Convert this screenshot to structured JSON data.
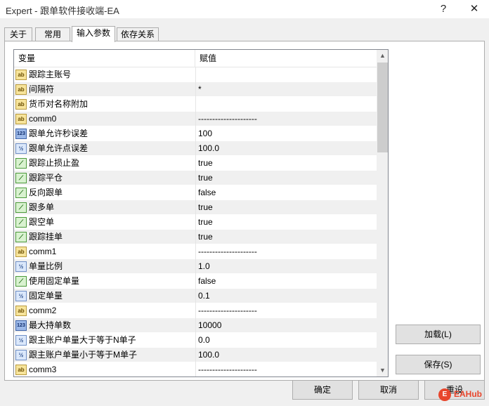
{
  "window": {
    "title": "Expert - 跟单软件接收端-EA",
    "help_glyph": "?",
    "close_glyph": "✕"
  },
  "tabs": [
    {
      "label": "关于"
    },
    {
      "label": "常用"
    },
    {
      "label": "输入参数",
      "active": true
    },
    {
      "label": "依存关系"
    }
  ],
  "grid": {
    "headers": {
      "variable": "变量",
      "value": "赋值"
    },
    "rows": [
      {
        "icon": "string-type-icon",
        "tag": "ab",
        "name": "跟踪主账号",
        "value": ""
      },
      {
        "icon": "string-type-icon",
        "tag": "ab",
        "name": "间隔符",
        "value": "*"
      },
      {
        "icon": "string-type-icon",
        "tag": "ab",
        "name": "货币对名称附加",
        "value": ""
      },
      {
        "icon": "string-type-icon",
        "tag": "ab",
        "name": "comm0",
        "value": "---------------------"
      },
      {
        "icon": "integer-type-icon",
        "tag": "123",
        "name": "跟单允许秒误差",
        "value": "100"
      },
      {
        "icon": "double-type-icon",
        "tag": "½",
        "name": "跟单允许点误差",
        "value": "100.0"
      },
      {
        "icon": "bool-type-icon",
        "tag": "⟋",
        "name": "跟踪止损止盈",
        "value": "true"
      },
      {
        "icon": "bool-type-icon",
        "tag": "⟋",
        "name": "跟踪平仓",
        "value": "true"
      },
      {
        "icon": "bool-type-icon",
        "tag": "⟋",
        "name": "反向跟单",
        "value": "false"
      },
      {
        "icon": "bool-type-icon",
        "tag": "⟋",
        "name": "跟多单",
        "value": "true"
      },
      {
        "icon": "bool-type-icon",
        "tag": "⟋",
        "name": "跟空单",
        "value": "true"
      },
      {
        "icon": "bool-type-icon",
        "tag": "⟋",
        "name": "跟踪挂单",
        "value": "true"
      },
      {
        "icon": "string-type-icon",
        "tag": "ab",
        "name": "comm1",
        "value": "---------------------"
      },
      {
        "icon": "double-type-icon",
        "tag": "½",
        "name": "单量比例",
        "value": "1.0"
      },
      {
        "icon": "bool-type-icon",
        "tag": "⟋",
        "name": "使用固定单量",
        "value": "false"
      },
      {
        "icon": "double-type-icon",
        "tag": "½",
        "name": "固定单量",
        "value": "0.1"
      },
      {
        "icon": "string-type-icon",
        "tag": "ab",
        "name": "comm2",
        "value": "---------------------"
      },
      {
        "icon": "integer-type-icon",
        "tag": "123",
        "name": "最大持单数",
        "value": "10000"
      },
      {
        "icon": "double-type-icon",
        "tag": "½",
        "name": "跟主账户单量大于等于N单子",
        "value": "0.0"
      },
      {
        "icon": "double-type-icon",
        "tag": "½",
        "name": "跟主账户单量小于等于M单子",
        "value": "100.0"
      },
      {
        "icon": "string-type-icon",
        "tag": "ab",
        "name": "comm3",
        "value": "---------------------"
      }
    ]
  },
  "scrollbar": {
    "up_glyph": "▲",
    "down_glyph": "▼"
  },
  "buttons": {
    "load": "加载(L)",
    "save": "保存(S)",
    "ok": "确定",
    "cancel": "取消",
    "reset": "重设"
  },
  "watermark": {
    "logo_char": "E",
    "text": "EAHub"
  },
  "colors": {
    "row_alt": "#f0f0f0",
    "string_icon": "#f7e49b",
    "bool_icon": "#d9f2d0",
    "int_icon": "#9bb8e8",
    "brand_watermark": "#e8462c"
  }
}
